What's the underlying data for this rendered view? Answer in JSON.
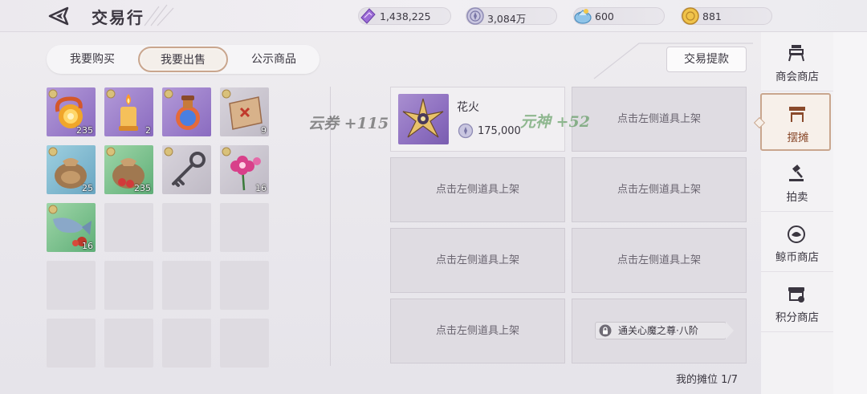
{
  "header": {
    "title": "交易行",
    "currencies": [
      {
        "icon": "purple-ticket-icon",
        "value": "1,438,225"
      },
      {
        "icon": "silver-coin-icon",
        "value": "3,084万"
      },
      {
        "icon": "blue-gem-icon",
        "value": "600"
      },
      {
        "icon": "gold-coin-icon",
        "value": "881"
      }
    ]
  },
  "tabs": [
    {
      "label": "我要购买",
      "active": false
    },
    {
      "label": "我要出售",
      "active": true
    },
    {
      "label": "公示商品",
      "active": false
    }
  ],
  "withdraw_label": "交易提款",
  "inventory": [
    {
      "icon": "golden-orb-icon",
      "qty": "235"
    },
    {
      "icon": "candle-icon",
      "qty": "2"
    },
    {
      "icon": "potion-bottle-icon",
      "qty": ""
    },
    {
      "icon": "treasure-map-icon",
      "qty": "9"
    },
    {
      "icon": "pouch-icon",
      "qty": "25"
    },
    {
      "icon": "red-pouch-icon",
      "qty": "235"
    },
    {
      "icon": "key-icon",
      "qty": ""
    },
    {
      "icon": "flower-icon",
      "qty": "16"
    },
    {
      "icon": "fish-icon",
      "qty": "16"
    }
  ],
  "stall": {
    "listed": {
      "name": "花火",
      "price": "175,000",
      "icon": "firework-flower-icon"
    },
    "empty_label": "点击左侧道具上架",
    "locked_label": "通关心魔之尊·八阶",
    "counter": "我的摊位 1/7"
  },
  "overlay": {
    "left_text": "云券 +115",
    "right_text": "元神 +52"
  },
  "sidebar": [
    {
      "label": "商会商店",
      "icon": "guild-shop-icon",
      "active": false
    },
    {
      "label": "摆摊",
      "icon": "stall-icon",
      "active": true
    },
    {
      "label": "拍卖",
      "icon": "auction-hammer-icon",
      "active": false
    },
    {
      "label": "鲸币商店",
      "icon": "whale-coin-icon",
      "active": false
    },
    {
      "label": "积分商店",
      "icon": "points-shop-icon",
      "active": false
    }
  ],
  "colors": {
    "accent_border": "#c9a68e",
    "active_text": "#8a4a2c"
  }
}
